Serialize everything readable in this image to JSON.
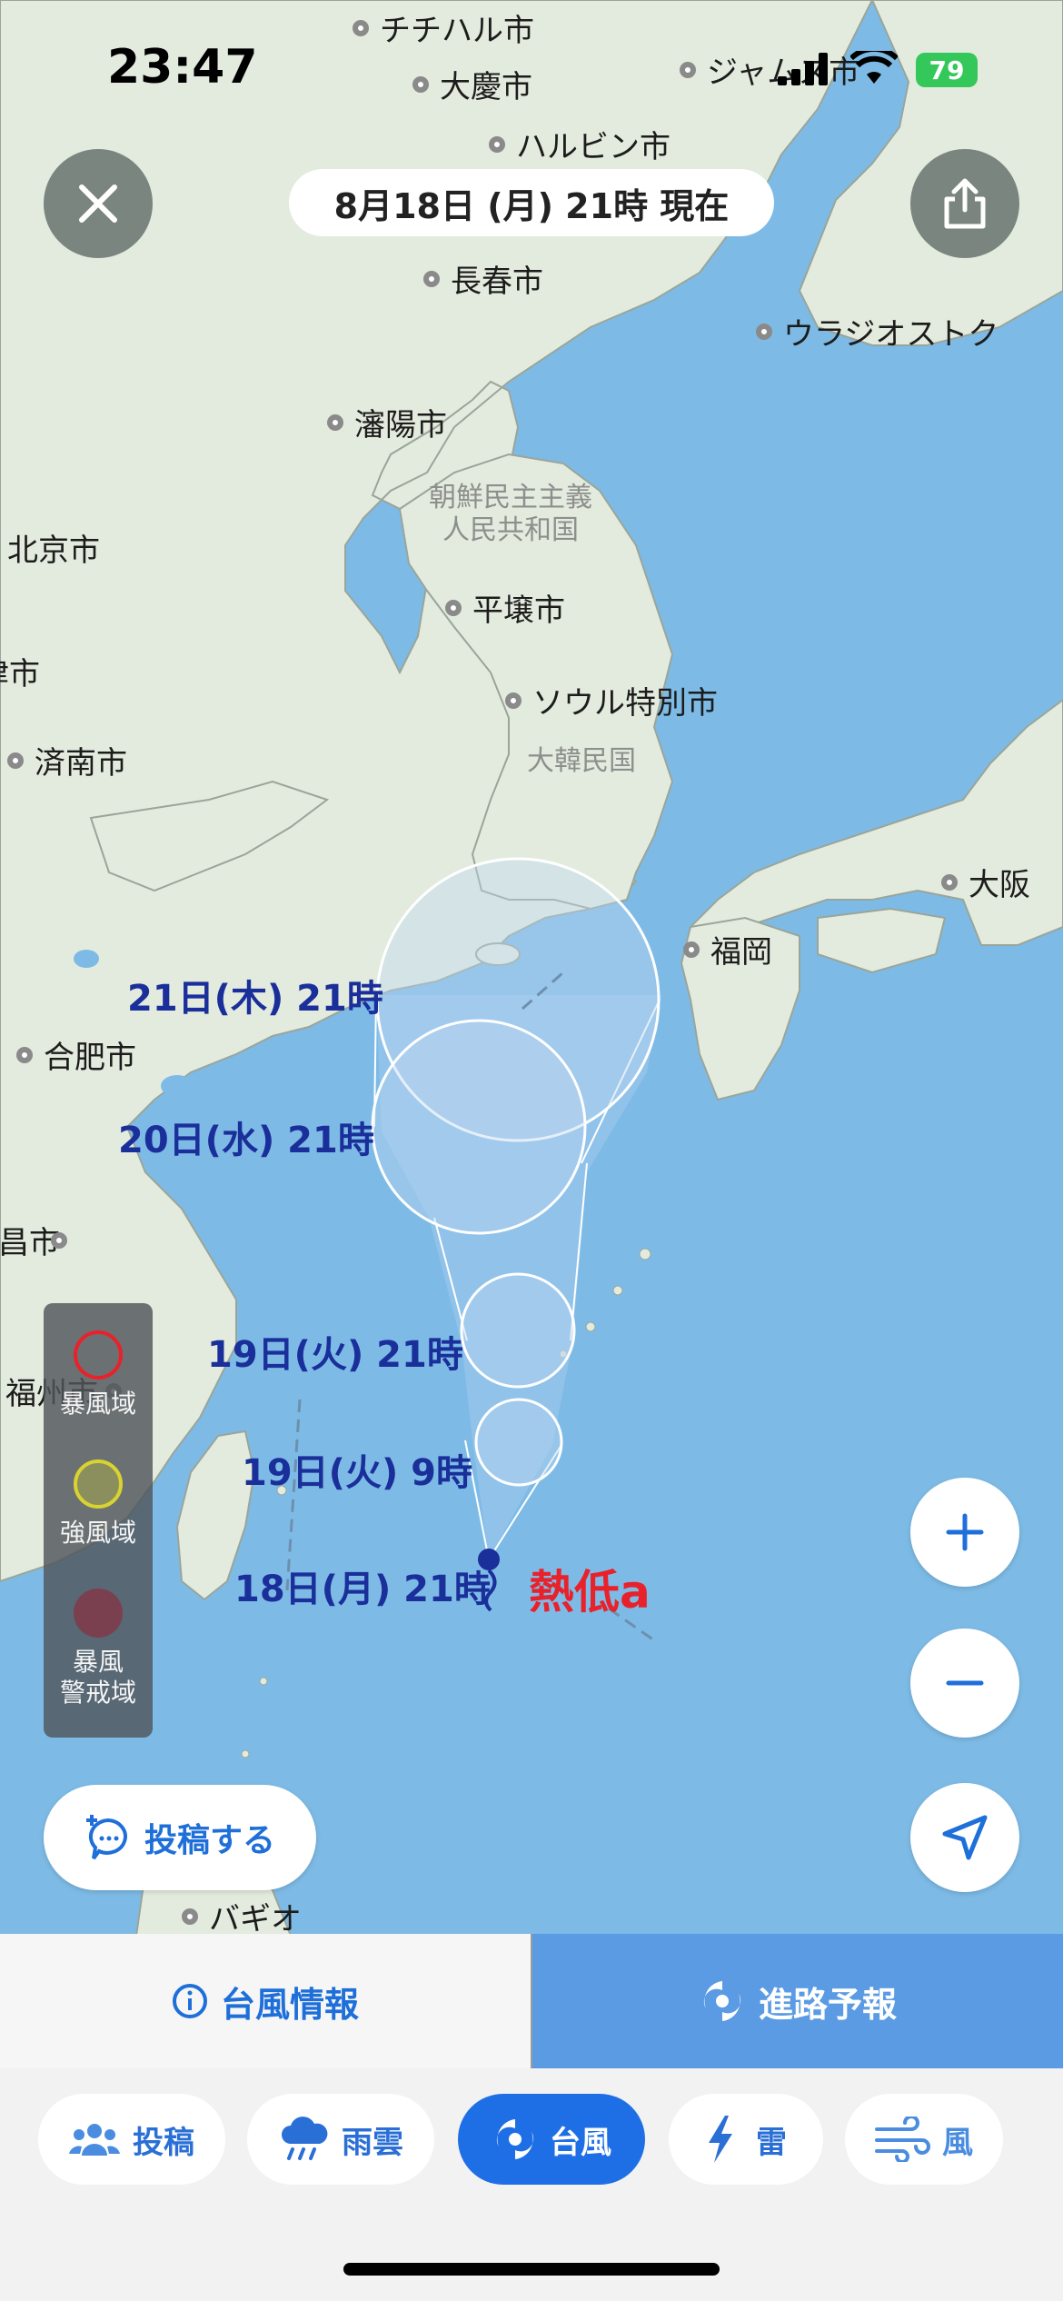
{
  "status": {
    "time": "23:47",
    "battery": "79"
  },
  "header": {
    "date_label": "8月18日 (月) 21時 現在"
  },
  "map": {
    "cities": [
      {
        "name": "チチハル市"
      },
      {
        "name": "大慶市"
      },
      {
        "name": "ジャムス市"
      },
      {
        "name": "ハルビン市"
      },
      {
        "name": "長春市"
      },
      {
        "name": "ウラジオストク"
      },
      {
        "name": "瀋陽市"
      },
      {
        "name": "北京市"
      },
      {
        "name": "平壌市"
      },
      {
        "name": "ソウル特別市"
      },
      {
        "name": "天津市"
      },
      {
        "name": "済南市"
      },
      {
        "name": "大阪"
      },
      {
        "name": "福岡"
      },
      {
        "name": "合肥市"
      },
      {
        "name": "南昌市"
      },
      {
        "name": "福州市"
      },
      {
        "name": "バギオ"
      }
    ],
    "countries": [
      {
        "name": "朝鮮民主主義\n人民共和国"
      },
      {
        "name": "大韓民国"
      }
    ],
    "forecast_labels": [
      {
        "text": "21日(木) 21時"
      },
      {
        "text": "20日(水) 21時"
      },
      {
        "text": "19日(火) 21時"
      },
      {
        "text": "19日(火) 9時"
      },
      {
        "text": "18日(月) 21時"
      }
    ],
    "storm_name": "熱低a"
  },
  "legend": {
    "storm_area": "暴風域",
    "strong_wind_area": "強風域",
    "warning_area": "暴風\n警戒域"
  },
  "colors": {
    "accent": "#1e6fd9",
    "route_tab": "#5b9be3",
    "storm_ring": "#e8212b",
    "wind_ring": "#d8d331",
    "warning": "#7a4050"
  },
  "post_button": {
    "label": "投稿する"
  },
  "tabs": [
    {
      "label": "台風情報",
      "icon": "info-icon"
    },
    {
      "label": "進路予報",
      "icon": "typhoon-icon"
    }
  ],
  "chips": [
    {
      "label": "投稿",
      "icon": "people-icon"
    },
    {
      "label": "雨雲",
      "icon": "rain-cloud-icon"
    },
    {
      "label": "台風",
      "icon": "typhoon-icon"
    },
    {
      "label": "雷",
      "icon": "lightning-icon"
    },
    {
      "label": "風",
      "icon": "wind-icon"
    }
  ]
}
